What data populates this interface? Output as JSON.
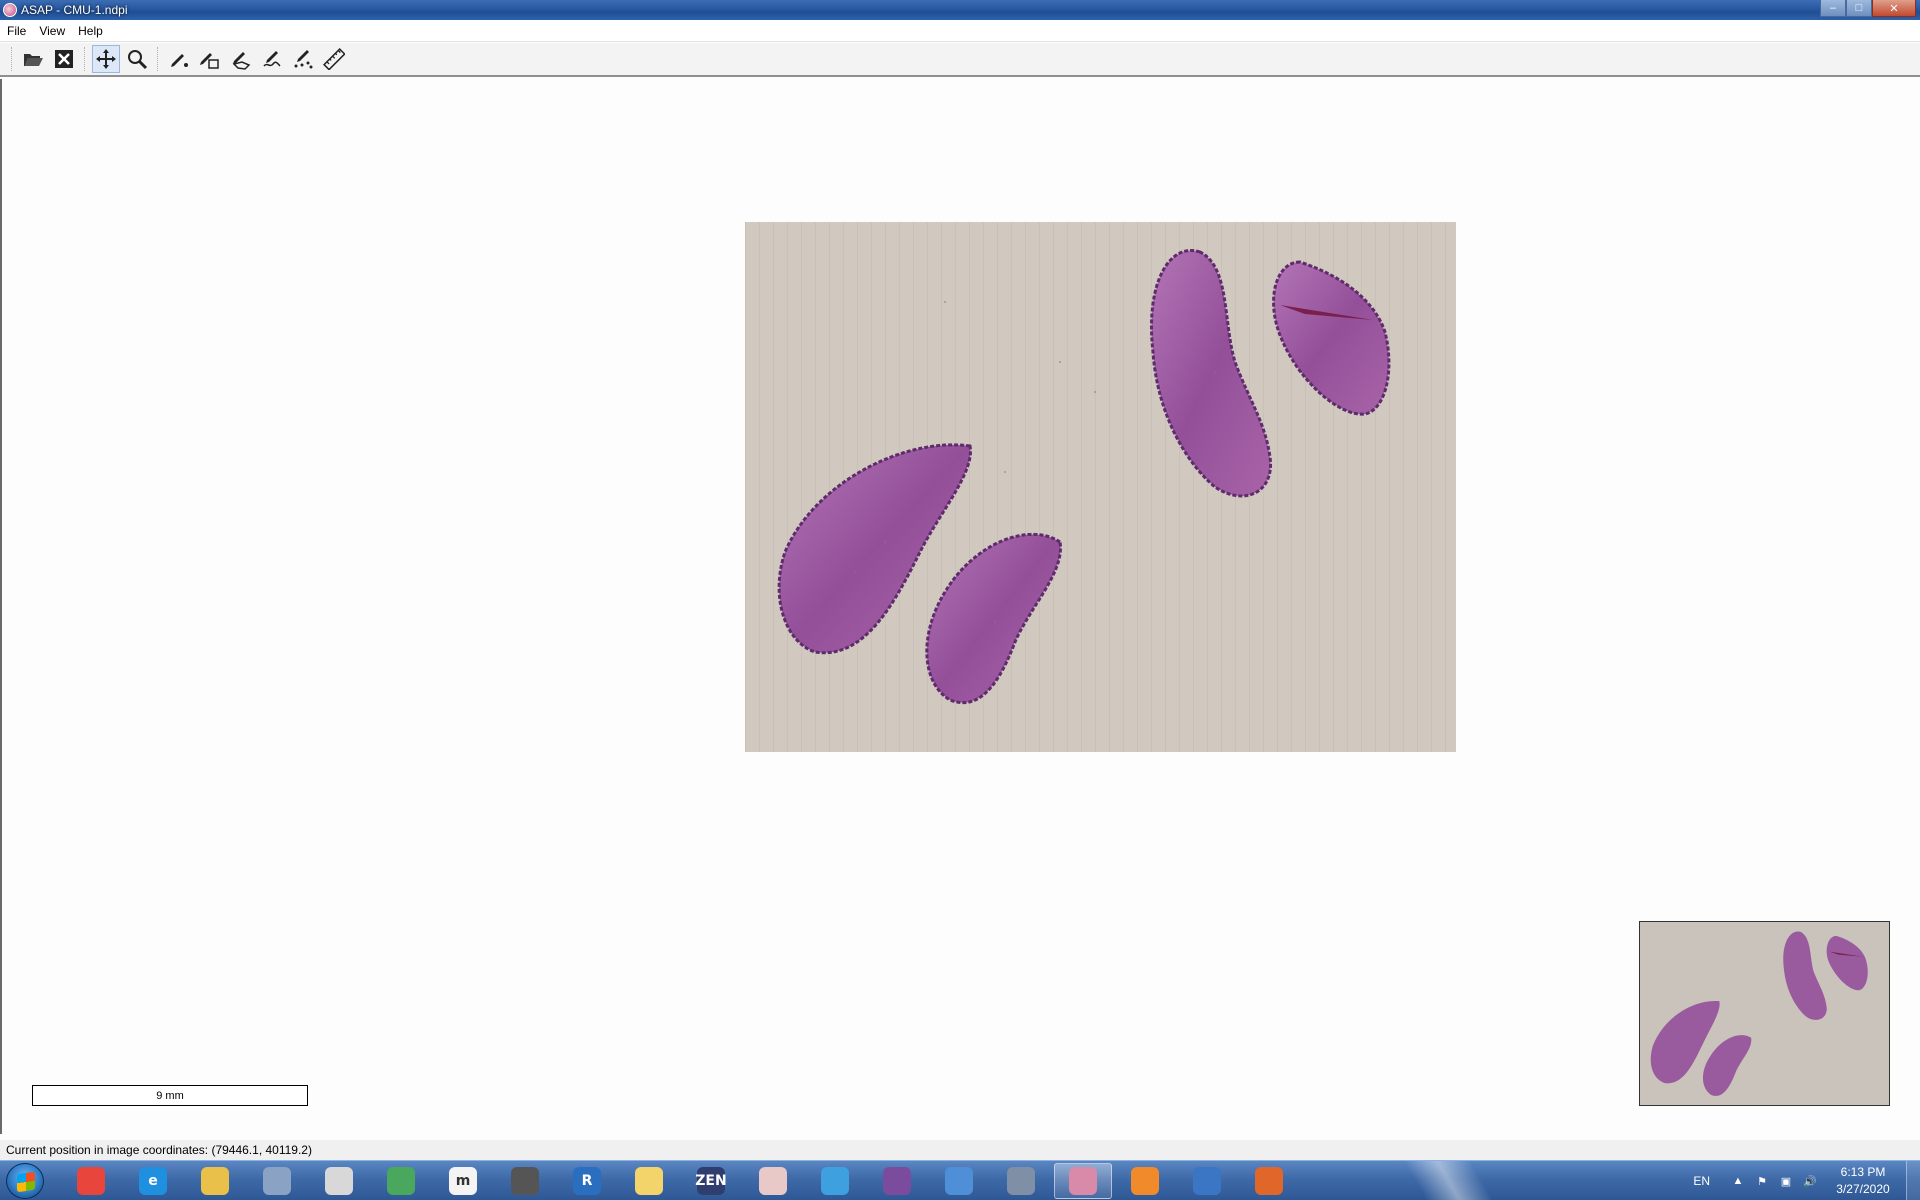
{
  "window": {
    "title": "ASAP - CMU-1.ndpi"
  },
  "menu": [
    "File",
    "View",
    "Help"
  ],
  "toolbar": {
    "buttons": [
      {
        "name": "open-file",
        "icon": "folder-open-icon"
      },
      {
        "name": "close-file",
        "icon": "close-x-icon"
      },
      {
        "name": "pan",
        "icon": "move-arrows-icon",
        "active": true
      },
      {
        "name": "zoom",
        "icon": "magnifier-icon"
      },
      {
        "name": "dot-annotation",
        "icon": "pen-dot-icon"
      },
      {
        "name": "rectangle-annotation",
        "icon": "pen-rectangle-icon"
      },
      {
        "name": "polygon-annotation",
        "icon": "pen-polygon-icon"
      },
      {
        "name": "spline-annotation",
        "icon": "pen-spline-icon"
      },
      {
        "name": "pointset-annotation",
        "icon": "pen-points-icon"
      },
      {
        "name": "measure",
        "icon": "ruler-icon"
      }
    ]
  },
  "viewer": {
    "scale_label": "9 mm",
    "slide_background": "#d1c9bf",
    "tissue_color": "#9a5a9e"
  },
  "status": {
    "text": "Current position in image coordinates: (79446.1, 40119.2)"
  },
  "taskbar": {
    "apps": [
      {
        "icon": "chrome-icon",
        "label": "",
        "color": "#e8453c"
      },
      {
        "icon": "internet-explorer-icon",
        "label": "e",
        "color": "#1f8fe0"
      },
      {
        "icon": "file-explorer-icon",
        "label": "",
        "color": "#e8c04a"
      },
      {
        "icon": "calculator-icon",
        "label": "",
        "color": "#8aa3c4"
      },
      {
        "icon": "speaker-icon",
        "label": "",
        "color": "#d8d8d8"
      },
      {
        "icon": "cubes-icon",
        "label": "",
        "color": "#4aa85e"
      },
      {
        "icon": "mu-editor-icon",
        "label": "m",
        "color": "#f4f4f4"
      },
      {
        "icon": "microphone-icon",
        "label": "",
        "color": "#555555"
      },
      {
        "icon": "r-language-icon",
        "label": "R",
        "color": "#2a6fbf"
      },
      {
        "icon": "paint-icon",
        "label": "",
        "color": "#f3d46a"
      },
      {
        "icon": "zen-icon",
        "label": "ZEN",
        "color": "#2f3e6e"
      },
      {
        "icon": "brain-icon",
        "label": "",
        "color": "#e9c8c8"
      },
      {
        "icon": "prism-icon",
        "label": "",
        "color": "#3fa0e0"
      },
      {
        "icon": "cat-icon",
        "label": "",
        "color": "#7b4c9e"
      },
      {
        "icon": "search-glass-icon",
        "label": "",
        "color": "#4f8fd8"
      },
      {
        "icon": "globe-search-icon",
        "label": "",
        "color": "#7e8fa6"
      },
      {
        "icon": "asap-icon",
        "label": "",
        "color": "#d98aa8",
        "open": true
      },
      {
        "icon": "firefox-icon",
        "label": "",
        "color": "#f18a2a"
      },
      {
        "icon": "remote-desktop-icon",
        "label": "",
        "color": "#3a76c4"
      },
      {
        "icon": "matlab-icon",
        "label": "",
        "color": "#e0662a"
      }
    ],
    "language": "EN",
    "time": "6:13 PM",
    "date": "3/27/2020"
  }
}
